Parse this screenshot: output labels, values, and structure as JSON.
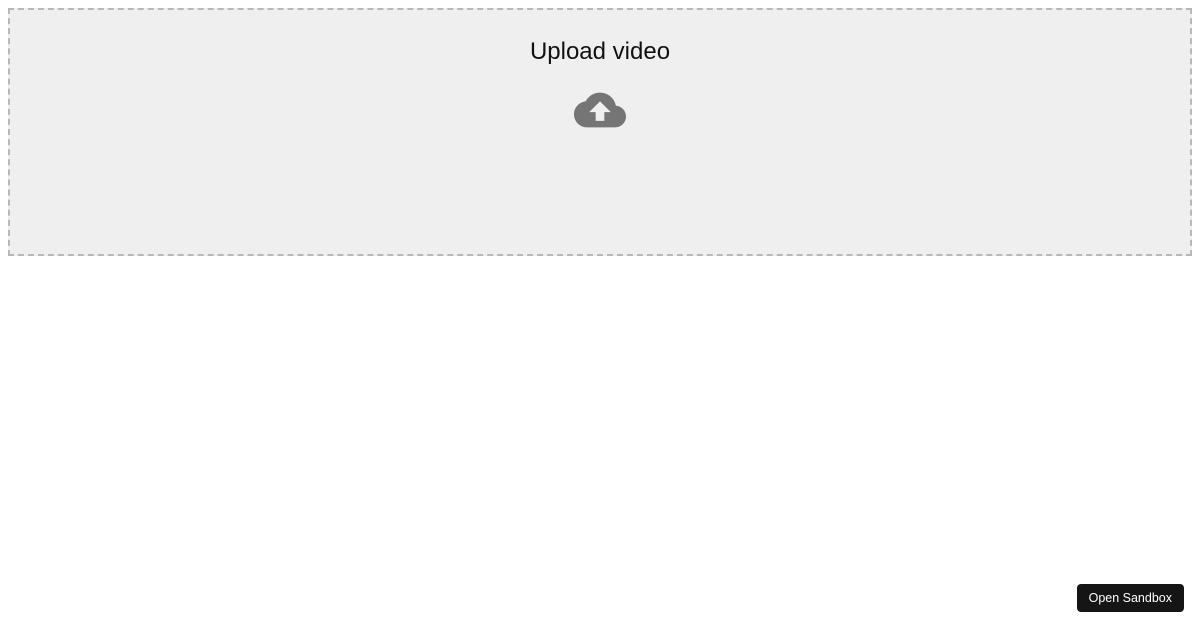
{
  "dropzone": {
    "title": "Upload video"
  },
  "actions": {
    "open_sandbox_label": "Open Sandbox"
  }
}
